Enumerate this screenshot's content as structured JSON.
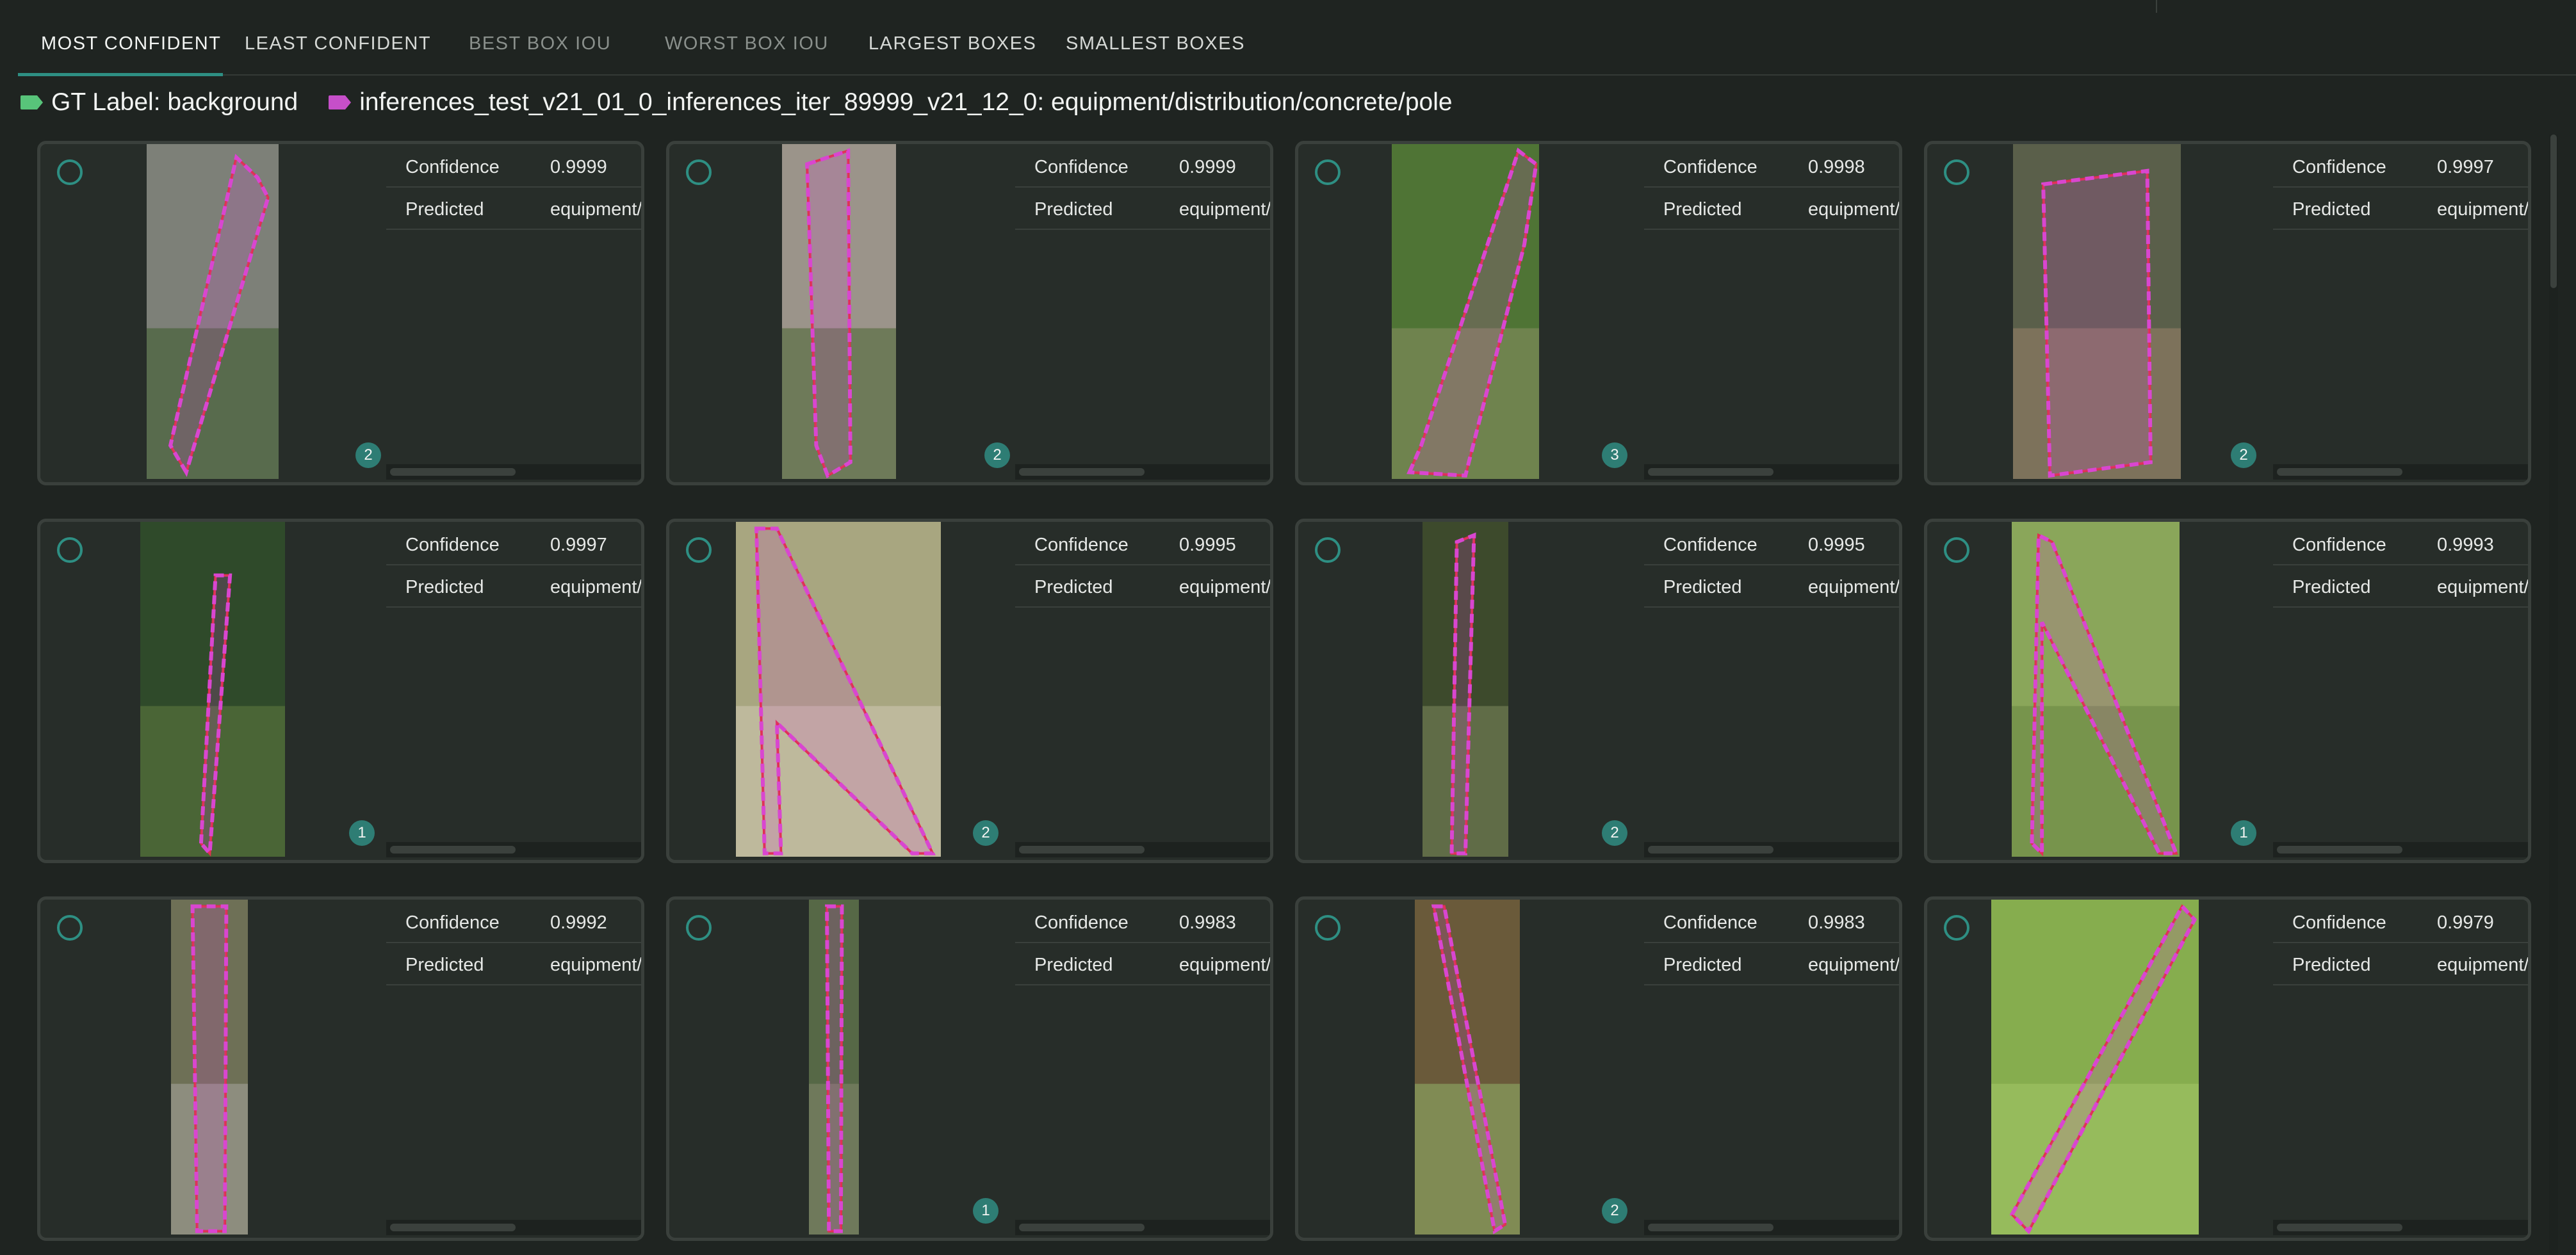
{
  "tabs": [
    {
      "label": "MOST CONFIDENT",
      "state": "active"
    },
    {
      "label": "LEAST CONFIDENT",
      "state": "normal"
    },
    {
      "label": "BEST BOX IOU",
      "state": "disabled"
    },
    {
      "label": "WORST BOX IOU",
      "state": "disabled"
    },
    {
      "label": "LARGEST BOXES",
      "state": "normal"
    },
    {
      "label": "SMALLEST BOXES",
      "state": "normal"
    }
  ],
  "legend": {
    "gt_label": "GT Label: background",
    "gt_color": "#58c47a",
    "inference_label": "inferences_test_v21_01_0_inferences_iter_89999_v21_12_0: equipment/distribution/concrete/pole",
    "inference_color": "#c64fc9"
  },
  "info_labels": {
    "confidence": "Confidence",
    "predicted": "Predicted"
  },
  "colors": {
    "accent": "#2e8f83",
    "prediction_box": "#d946d0",
    "gt_box": "#e0304f"
  },
  "cards": [
    {
      "confidence": "0.9999",
      "predicted": "equipment/distribution/concrete/pole",
      "badge": "2",
      "bg": "#7d8078",
      "fg": "#48623a"
    },
    {
      "confidence": "0.9999",
      "predicted": "equipment/distribution/concrete/pole",
      "badge": "2",
      "bg": "#9b948a",
      "fg": "#5b6f45"
    },
    {
      "confidence": "0.9998",
      "predicted": "equipment/distribution/concrete/pole",
      "badge": "3",
      "bg": "#4f7435",
      "fg": "#7d8a5a"
    },
    {
      "confidence": "0.9997",
      "predicted": "equipment/distribution/concrete/pole",
      "badge": "2",
      "bg": "#5a5f4a",
      "fg": "#8c7a62"
    },
    {
      "confidence": "0.9997",
      "predicted": "equipment/distribution/concrete/pole",
      "badge": "1",
      "bg": "#2f4a2a",
      "fg": "#55703c"
    },
    {
      "confidence": "0.9995",
      "predicted": "equipment/distribution/concrete/pole",
      "badge": "2",
      "bg": "#a8a680",
      "fg": "#c8c2a8"
    },
    {
      "confidence": "0.9995",
      "predicted": "equipment/distribution/concrete/pole",
      "badge": "2",
      "bg": "#3d4a2c",
      "fg": "#6f7a52"
    },
    {
      "confidence": "0.9993",
      "predicted": "equipment/distribution/concrete/pole",
      "badge": "1",
      "bg": "#8aa65a",
      "fg": "#6f8d46"
    },
    {
      "confidence": "0.9992",
      "predicted": "equipment/distribution/concrete/pole",
      "badge": "",
      "bg": "#6e7056",
      "fg": "#9a9a90"
    },
    {
      "confidence": "0.9983",
      "predicted": "equipment/distribution/concrete/pole",
      "badge": "1",
      "bg": "#566846",
      "fg": "#7a8064"
    },
    {
      "confidence": "0.9983",
      "predicted": "equipment/distribution/concrete/pole",
      "badge": "2",
      "bg": "#6a5a3a",
      "fg": "#8aa060"
    },
    {
      "confidence": "0.9979",
      "predicted": "equipment/distribution/concrete/pole",
      "badge": "",
      "bg": "#86ad4e",
      "fg": "#9cc062"
    }
  ]
}
